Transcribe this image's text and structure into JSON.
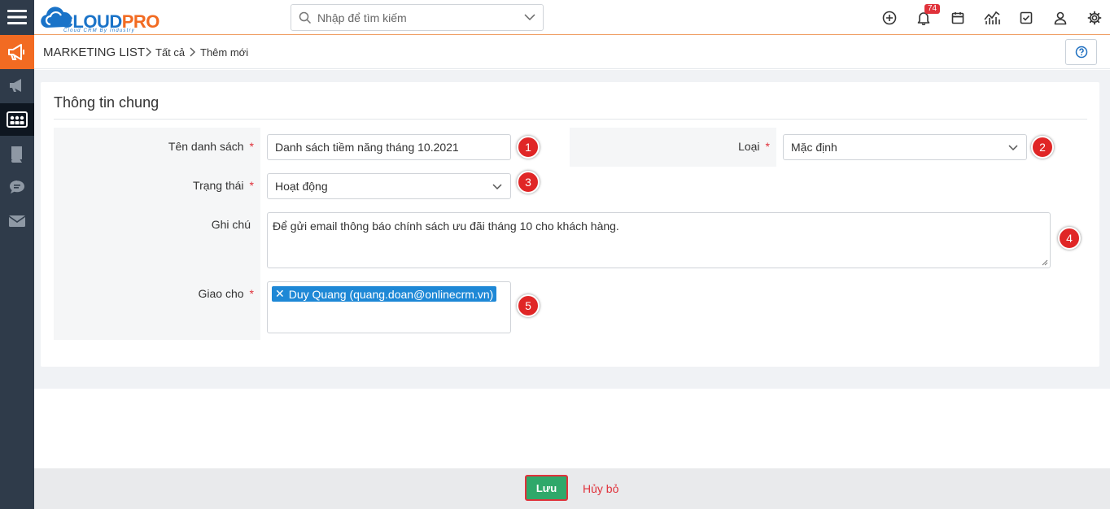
{
  "app": {
    "logo": "CLOUDPRO",
    "logo_part1": "CLOUD",
    "logo_part2": "PRO",
    "logo_tagline": "Cloud CRM By Industry"
  },
  "search": {
    "placeholder": "Nhập để tìm kiếm"
  },
  "header": {
    "notification_count": "74"
  },
  "breadcrumb": {
    "module": "MARKETING LIST",
    "level1": "Tất cả",
    "level2": "Thêm mới"
  },
  "form": {
    "section_title": "Thông tin chung",
    "fields": {
      "name": {
        "label": "Tên danh sách",
        "value": "Danh sách tiềm năng tháng 10.2021",
        "marker": "1"
      },
      "type": {
        "label": "Loại",
        "value": "Mặc định",
        "marker": "2"
      },
      "status": {
        "label": "Trạng thái",
        "value": "Hoạt động",
        "marker": "3"
      },
      "note": {
        "label": "Ghi chú",
        "value": "Để gửi email thông báo chính sách ưu đãi tháng 10 cho khách hàng.",
        "marker": "4"
      },
      "assign": {
        "label": "Giao cho",
        "value": "Duy Quang (quang.doan@onlinecrm.vn)",
        "marker": "5"
      }
    },
    "required_mark": "*"
  },
  "footer": {
    "save_label": "Lưu",
    "cancel_label": "Hủy bỏ"
  },
  "colors": {
    "sidebar": "#2f3b4a",
    "accent": "#f26b22",
    "save": "#2fa86a",
    "danger": "#e0323b",
    "tag": "#1e88d6"
  }
}
